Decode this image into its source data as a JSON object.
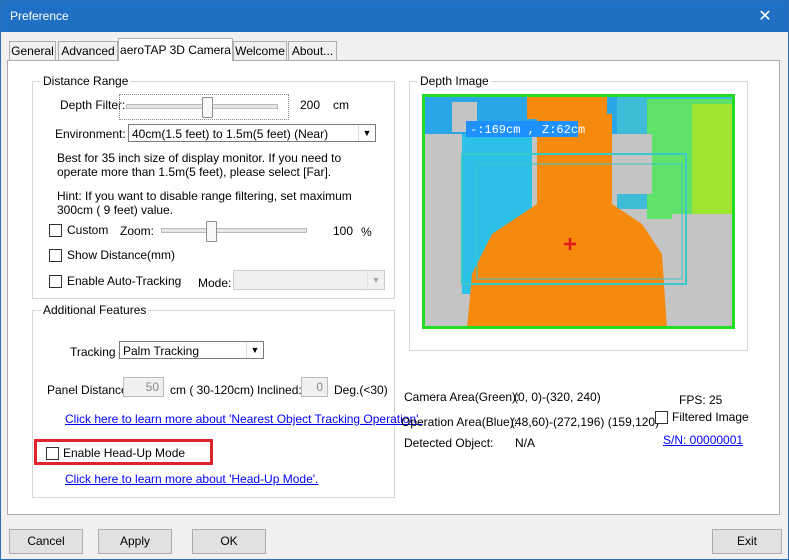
{
  "window": {
    "title": "Preference",
    "close_glyph": "✕"
  },
  "tabs": [
    "General",
    "Advanced",
    "aeroTAP 3D Camera",
    "Welcome",
    "About..."
  ],
  "distance_range": {
    "legend": "Distance Range",
    "depth_filter_label": "Depth Filter:",
    "depth_filter_value": "200",
    "depth_filter_unit": "cm",
    "depth_filter_level_fraction": 0.54,
    "environment_label": "Environment:",
    "environment_value": "40cm(1.5 feet) to 1.5m(5 feet) (Near)",
    "description": "Best for 35 inch size of display monitor. If you need to operate more than 1.5m(5 feet), please select [Far].",
    "hint": "Hint: If you want to disable range filtering, set maximum 300cm ( 9 feet) value.",
    "custom_label": "Custom",
    "zoom_label": "Zoom:",
    "zoom_value": "100",
    "zoom_unit": "%",
    "zoom_level_fraction": 0.35,
    "show_distance_label": "Show Distance(mm)",
    "auto_tracking_label": "Enable Auto-Tracking",
    "mode_label": "Mode:",
    "mode_value": ""
  },
  "additional_features": {
    "legend": "Additional Features",
    "tracking_label": "Tracking",
    "tracking_value": "Palm Tracking",
    "panel_distance_label": "Panel Distance:",
    "panel_distance_value": "50",
    "panel_distance_unit": "cm ( 30-120cm)",
    "inclined_label": "Inclined:",
    "inclined_value": "0",
    "inclined_unit": "Deg.(<30)",
    "nearest_link": "Click here to learn more about 'Nearest Object Tracking Operation'.",
    "headup_label": "Enable Head-Up Mode",
    "headup_link": "Click here to learn more about 'Head-Up Mode'."
  },
  "depth_image": {
    "legend": "Depth Image",
    "overlay_text": "-:169cm , Z:62cm"
  },
  "status": {
    "camera_area_label": "Camera Area(Green):",
    "camera_area_value": "(0, 0)-(320, 240)",
    "operation_area_label": "Operation Area(Blue):",
    "operation_area_value": "(48,60)-(272,196) (159,120)",
    "detected_label": "Detected Object:",
    "detected_value": "N/A",
    "fps": "FPS: 25",
    "filtered_label": "Filtered Image",
    "serial_link": "S/N: 00000001"
  },
  "buttons": {
    "cancel": "Cancel",
    "apply": "Apply",
    "ok": "OK",
    "exit": "Exit"
  },
  "colors": {
    "titlebar": "#1f6fc5",
    "highlight": "#e0242e",
    "link": "#0000ff",
    "camera_area": "#22dd22",
    "operation_area": "#38c8c8"
  }
}
